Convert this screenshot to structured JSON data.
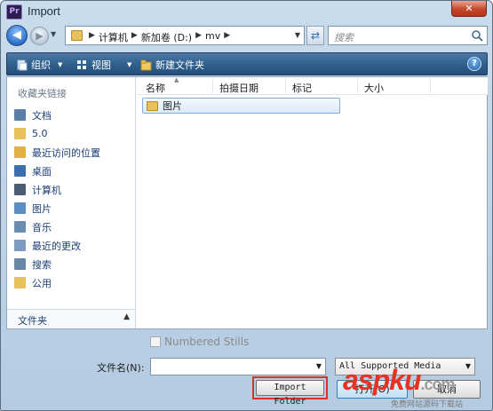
{
  "window": {
    "title": "Import",
    "app_icon_label": "Pr",
    "close_label": "✕"
  },
  "address": {
    "crumbs": [
      "计算机",
      "新加卷 (D:)",
      "mv"
    ],
    "search_placeholder": "搜索"
  },
  "toolbar": {
    "organize_label": "组织",
    "views_label": "视图",
    "new_folder_label": "新建文件夹",
    "help_label": "?"
  },
  "sidebar": {
    "header": "收藏夹链接",
    "items": [
      {
        "label": "文档",
        "icon": "document-icon",
        "color": "#5a7fa8"
      },
      {
        "label": "5.0",
        "icon": "folder-icon",
        "color": "#e8c15a"
      },
      {
        "label": "最近访问的位置",
        "icon": "recent-places-icon",
        "color": "#e2b043"
      },
      {
        "label": "桌面",
        "icon": "desktop-icon",
        "color": "#3b6fb0"
      },
      {
        "label": "计算机",
        "icon": "computer-icon",
        "color": "#4a5d75"
      },
      {
        "label": "图片",
        "icon": "pictures-icon",
        "color": "#5b8fc4"
      },
      {
        "label": "音乐",
        "icon": "music-icon",
        "color": "#6d8db0"
      },
      {
        "label": "最近的更改",
        "icon": "recent-changes-icon",
        "color": "#7d9bc0"
      },
      {
        "label": "搜索",
        "icon": "search-folder-icon",
        "color": "#6a86a6"
      },
      {
        "label": "公用",
        "icon": "public-folder-icon",
        "color": "#e8c15a"
      }
    ],
    "folder_tree_label": "文件夹"
  },
  "file_list": {
    "columns": [
      "名称",
      "拍摄日期",
      "标记",
      "大小"
    ],
    "rows": [
      {
        "name": "图片"
      }
    ]
  },
  "bottom": {
    "numbered_stills_label": "Numbered Stills",
    "filename_label": "文件名(N):",
    "filename_value": "",
    "file_type_value": "All Supported Media",
    "import_folder_label": "Import Folder",
    "open_label": "打开(O)",
    "cancel_label": "取消"
  },
  "watermark": {
    "brand_main": "aspku",
    "brand_cn": "",
    "brand_tld": ".com",
    "tagline": "免费网站源码下载站"
  },
  "colors": {
    "accent": "#2a6fc8",
    "toolbar": "#30618f",
    "highlight": "#d9322b",
    "watermark": "#e53424"
  }
}
